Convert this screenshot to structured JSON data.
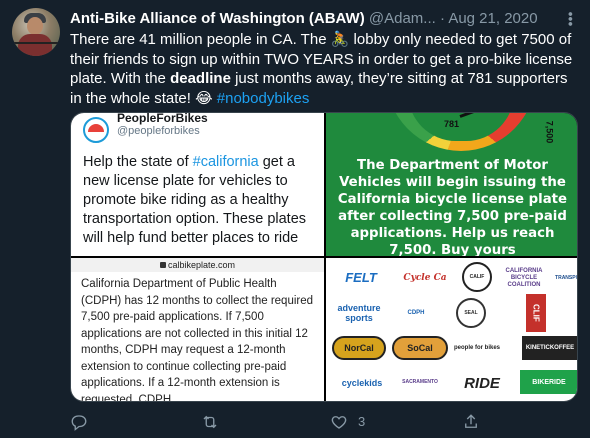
{
  "tweet": {
    "author_name": "Anti-Bike Alliance of Washington (ABAW)",
    "handle": "@Adam...",
    "separator": "·",
    "date": "Aug 21, 2020",
    "text_part1": "There are 41 million people in CA. The ",
    "emoji_bike": "🚴",
    "text_part2": " lobby only needed to get 7500 of their friends to sign up within TWO YEARS in order to get a pro-bike license plate. With the ",
    "bold_word": "deadline",
    "text_part3": " just months away, they’re sitting at 781 supporters in the whole state! ",
    "emoji_laugh": "😂",
    "hashtag": "#nobodybikes"
  },
  "media": {
    "pfb": {
      "name": "PeopleForBikes",
      "handle": "@peopleforbikes",
      "text_part1": "Help the state of ",
      "hashtag": "#california",
      "text_part2": " get a new license plate for vehicles to promote bike riding as a healthy transportation option. These plates will help fund better places to ride"
    },
    "dmv": {
      "gauge_value": "781",
      "gauge_max": "7,500",
      "text": "The Department of Motor Vehicles will begin issuing the California bicycle license plate after collecting 7,500 pre-paid applications. Help us reach 7,500. Buy yours"
    },
    "cdph": {
      "url": "calbikeplate.com",
      "text": "California Department of Public Health (CDPH) has 12 months to collect the required 7,500 pre-paid applications. If 7,500 applications are not collected in this initial 12 months, CDPH may request a 12-month extension to continue collecting pre-paid applications. If a 12-month extension is requested, CDPH"
    },
    "sponsors": {
      "felt": "FELT",
      "cycle": "Cycle Ca",
      "circle": "CALIF",
      "cabc": "CALIFORNIA BICYCLE COALITION",
      "trans": "TRANSPORTATION",
      "adventure": "adventure sports",
      "cdph": "CDPH",
      "seal": "SEAL",
      "clif": "CLIF",
      "norcal": "NorCal",
      "socal": "SoCal",
      "pfb": "people for bikes",
      "kinetic": "KINETICKOFFEE",
      "cyclekids": "cyclekids",
      "sac": "SACRAMENTO",
      "ride": "RIDE",
      "bikeride": "BIKERIDE"
    }
  },
  "actions": {
    "like_count": "3"
  }
}
